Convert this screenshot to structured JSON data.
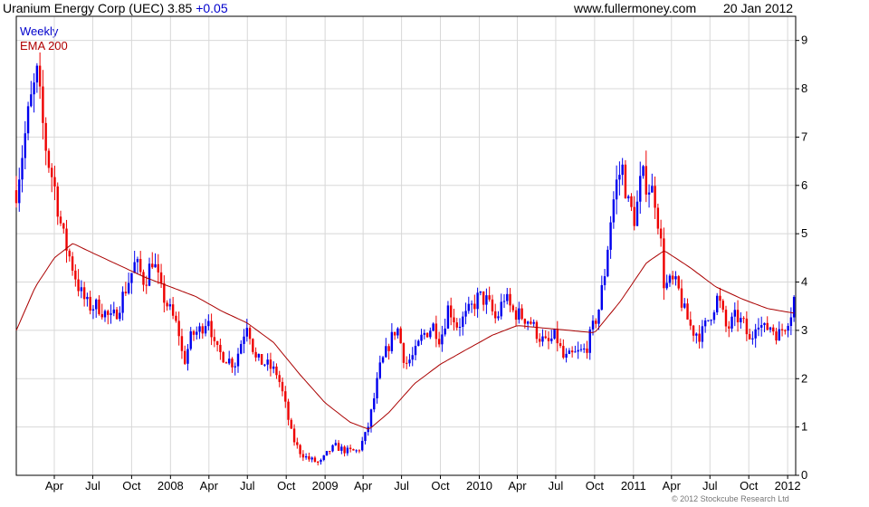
{
  "header": {
    "title": "Uranium Energy Corp (UEC) 3.85",
    "change": "+0.05",
    "site": "www.fullermoney.com",
    "date": "20 Jan 2012"
  },
  "footer": {
    "copyright": "© 2012 Stockcube Research Ltd"
  },
  "colors": {
    "up": "#0000ee",
    "down": "#ee0000",
    "ema": "#aa0000",
    "grid": "#d8d8d8"
  },
  "chart_data": {
    "type": "candlestick",
    "frequency": "weekly",
    "legend": [
      "Weekly",
      "EMA 200"
    ],
    "legend_position": "top-left",
    "grid": true,
    "y_axis_side": "right",
    "ylim": [
      0,
      9.5
    ],
    "y_ticks": [
      0,
      1,
      2,
      3,
      4,
      5,
      6,
      7,
      8,
      9
    ],
    "x_tick_labels": [
      "Apr",
      "Jul",
      "Oct",
      "2008",
      "Apr",
      "Jul",
      "Oct",
      "2009",
      "Apr",
      "Jul",
      "Oct",
      "2010",
      "Apr",
      "Jul",
      "Oct",
      "2011",
      "Apr",
      "Jul",
      "Oct",
      "2012"
    ],
    "x_start": "2007-01-01",
    "x_end": "2012-01-20",
    "price_keypoints": [
      [
        "2007-01-01",
        5.9
      ],
      [
        "2007-02-01",
        7.6
      ],
      [
        "2007-02-20",
        8.3
      ],
      [
        "2007-03-01",
        7.5
      ],
      [
        "2007-03-15",
        6.6
      ],
      [
        "2007-04-01",
        6.0
      ],
      [
        "2007-04-20",
        5.0
      ],
      [
        "2007-05-15",
        4.3
      ],
      [
        "2007-06-01",
        3.8
      ],
      [
        "2007-06-20",
        3.5
      ],
      [
        "2007-07-15",
        3.5
      ],
      [
        "2007-08-15",
        3.2
      ],
      [
        "2007-09-01",
        3.5
      ],
      [
        "2007-10-10",
        4.4
      ],
      [
        "2007-11-01",
        4.0
      ],
      [
        "2007-11-20",
        4.5
      ],
      [
        "2007-12-10",
        3.8
      ],
      [
        "2007-12-31",
        3.4
      ],
      [
        "2008-01-20",
        3.0
      ],
      [
        "2008-02-01",
        2.3
      ],
      [
        "2008-02-20",
        2.9
      ],
      [
        "2008-03-10",
        3.0
      ],
      [
        "2008-04-01",
        3.3
      ],
      [
        "2008-04-15",
        2.6
      ],
      [
        "2008-05-01",
        2.5
      ],
      [
        "2008-06-01",
        2.3
      ],
      [
        "2008-07-01",
        3.2
      ],
      [
        "2008-07-20",
        2.4
      ],
      [
        "2008-08-15",
        2.3
      ],
      [
        "2008-09-10",
        2.1
      ],
      [
        "2008-09-25",
        1.6
      ],
      [
        "2008-10-15",
        0.8
      ],
      [
        "2008-11-01",
        0.5
      ],
      [
        "2008-11-20",
        0.35
      ],
      [
        "2008-12-20",
        0.25
      ],
      [
        "2009-01-10",
        0.5
      ],
      [
        "2009-01-25",
        0.6
      ],
      [
        "2009-02-20",
        0.5
      ],
      [
        "2009-03-20",
        0.5
      ],
      [
        "2009-04-10",
        0.9
      ],
      [
        "2009-04-25",
        1.5
      ],
      [
        "2009-05-10",
        2.2
      ],
      [
        "2009-06-01",
        2.7
      ],
      [
        "2009-06-20",
        3.1
      ],
      [
        "2009-07-10",
        2.3
      ],
      [
        "2009-08-01",
        2.5
      ],
      [
        "2009-08-20",
        2.9
      ],
      [
        "2009-09-15",
        3.1
      ],
      [
        "2009-10-01",
        2.8
      ],
      [
        "2009-10-20",
        3.5
      ],
      [
        "2009-11-10",
        3.1
      ],
      [
        "2009-12-01",
        3.3
      ],
      [
        "2009-12-31",
        3.7
      ],
      [
        "2010-01-20",
        3.6
      ],
      [
        "2010-02-10",
        3.2
      ],
      [
        "2010-03-01",
        3.7
      ],
      [
        "2010-03-20",
        3.4
      ],
      [
        "2010-04-10",
        3.3
      ],
      [
        "2010-05-01",
        3.2
      ],
      [
        "2010-05-20",
        2.9
      ],
      [
        "2010-06-10",
        2.7
      ],
      [
        "2010-07-01",
        2.9
      ],
      [
        "2010-07-20",
        2.4
      ],
      [
        "2010-08-15",
        2.5
      ],
      [
        "2010-09-10",
        2.6
      ],
      [
        "2010-09-25",
        3.0
      ],
      [
        "2010-10-10",
        3.4
      ],
      [
        "2010-10-25",
        4.2
      ],
      [
        "2010-11-08",
        5.3
      ],
      [
        "2010-11-20",
        6.0
      ],
      [
        "2010-12-05",
        6.4
      ],
      [
        "2010-12-20",
        5.6
      ],
      [
        "2011-01-05",
        5.3
      ],
      [
        "2011-01-20",
        6.2
      ],
      [
        "2011-02-05",
        6.0
      ],
      [
        "2011-02-20",
        5.8
      ],
      [
        "2011-03-05",
        5.0
      ],
      [
        "2011-03-15",
        3.9
      ],
      [
        "2011-04-01",
        4.0
      ],
      [
        "2011-04-15",
        3.9
      ],
      [
        "2011-05-01",
        3.4
      ],
      [
        "2011-05-20",
        3.0
      ],
      [
        "2011-06-10",
        2.9
      ],
      [
        "2011-07-01",
        3.3
      ],
      [
        "2011-07-20",
        3.7
      ],
      [
        "2011-08-10",
        3.0
      ],
      [
        "2011-09-01",
        3.3
      ],
      [
        "2011-09-20",
        3.1
      ],
      [
        "2011-10-05",
        2.7
      ],
      [
        "2011-10-20",
        3.3
      ],
      [
        "2011-11-05",
        3.0
      ],
      [
        "2011-11-20",
        3.1
      ],
      [
        "2011-12-10",
        2.9
      ],
      [
        "2011-12-25",
        3.1
      ],
      [
        "2012-01-10",
        3.4
      ],
      [
        "2012-01-20",
        3.85
      ]
    ],
    "ema_keypoints": [
      [
        "2007-01-01",
        3.0
      ],
      [
        "2007-02-15",
        3.9
      ],
      [
        "2007-04-01",
        4.5
      ],
      [
        "2007-05-15",
        4.8
      ],
      [
        "2007-07-01",
        4.6
      ],
      [
        "2007-09-01",
        4.35
      ],
      [
        "2007-11-01",
        4.1
      ],
      [
        "2008-01-01",
        3.9
      ],
      [
        "2008-03-01",
        3.7
      ],
      [
        "2008-05-01",
        3.4
      ],
      [
        "2008-07-01",
        3.15
      ],
      [
        "2008-09-01",
        2.75
      ],
      [
        "2008-11-01",
        2.1
      ],
      [
        "2009-01-01",
        1.5
      ],
      [
        "2009-03-01",
        1.1
      ],
      [
        "2009-04-15",
        0.95
      ],
      [
        "2009-06-01",
        1.3
      ],
      [
        "2009-08-01",
        1.9
      ],
      [
        "2009-10-01",
        2.3
      ],
      [
        "2009-12-01",
        2.6
      ],
      [
        "2010-02-01",
        2.9
      ],
      [
        "2010-04-01",
        3.1
      ],
      [
        "2010-06-01",
        3.05
      ],
      [
        "2010-08-01",
        3.0
      ],
      [
        "2010-10-01",
        2.95
      ],
      [
        "2010-12-01",
        3.6
      ],
      [
        "2011-02-01",
        4.4
      ],
      [
        "2011-03-15",
        4.65
      ],
      [
        "2011-05-15",
        4.3
      ],
      [
        "2011-07-15",
        3.9
      ],
      [
        "2011-09-15",
        3.65
      ],
      [
        "2011-11-15",
        3.45
      ],
      [
        "2012-01-20",
        3.35
      ]
    ]
  }
}
